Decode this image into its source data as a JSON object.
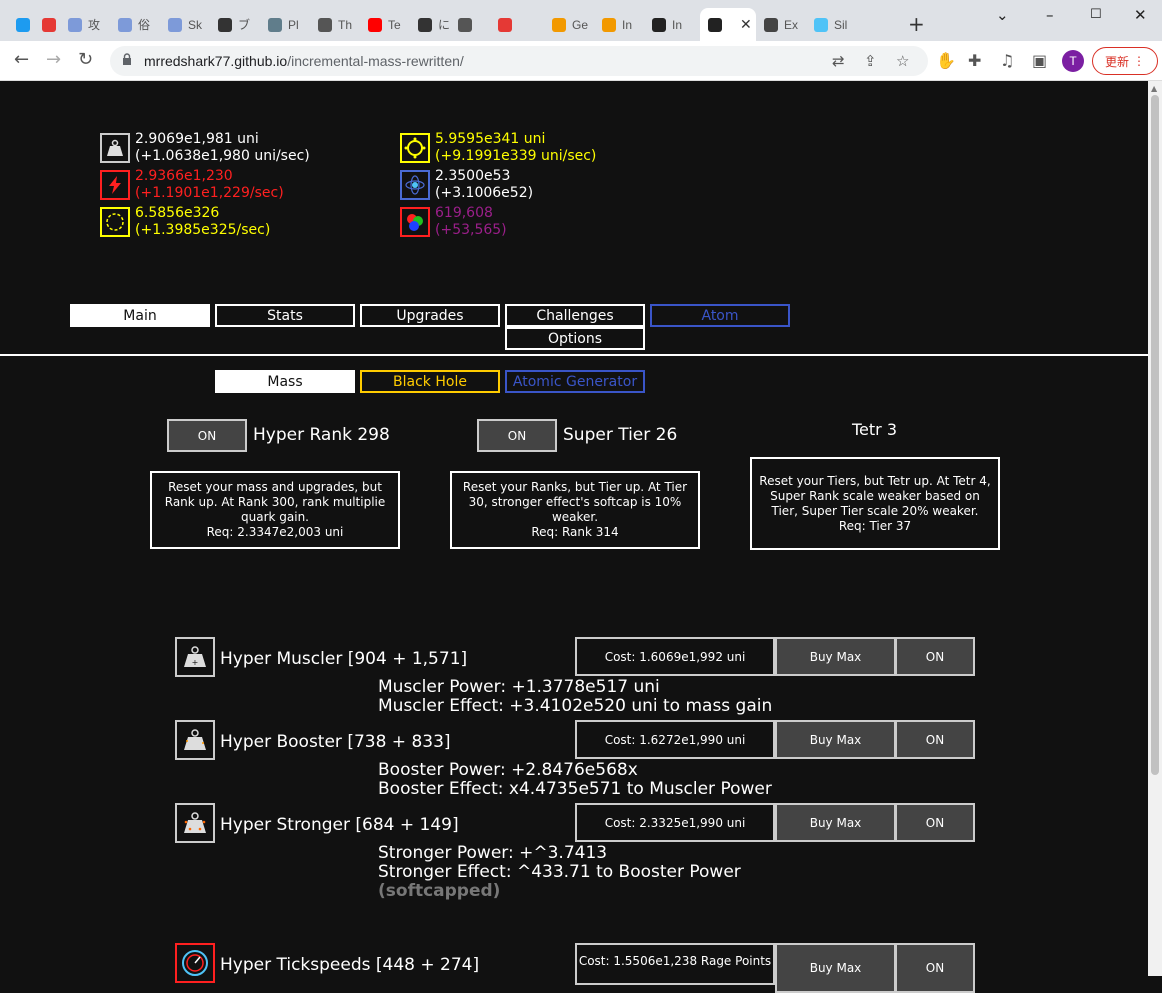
{
  "browser": {
    "tabs": [
      {
        "label": "",
        "color": "#1d9bf0"
      },
      {
        "label": "",
        "color": "#e53935"
      },
      {
        "label": "攻",
        "color": "#7d9ad9"
      },
      {
        "label": "俗",
        "color": "#7d9ad9"
      },
      {
        "label": "Sk",
        "color": "#7d9ad9"
      },
      {
        "label": "ブ",
        "color": "#333333"
      },
      {
        "label": "Pl",
        "color": "#607d8b"
      },
      {
        "label": "Th",
        "color": "#555555"
      },
      {
        "label": "Te",
        "color": "#ff0000"
      },
      {
        "label": "に",
        "color": "#333333"
      },
      {
        "label": "",
        "color": "#555555"
      },
      {
        "label": "",
        "color": "#e53935"
      },
      {
        "label": "Ge",
        "color": "#f29900"
      },
      {
        "label": "In",
        "color": "#f29900"
      },
      {
        "label": "In",
        "color": "#222222"
      },
      {
        "label": "",
        "color": "#222222"
      },
      {
        "label": "Ex",
        "color": "#444444"
      },
      {
        "label": "Sil",
        "color": "#4fc3f7"
      }
    ],
    "url_host": "mrredshark77.github.io",
    "url_path": "/incremental-mass-rewritten/",
    "avatar": "T",
    "update_label": "更新"
  },
  "resources": {
    "mass": {
      "value": "2.9069e1,981 uni",
      "rate": "(+1.0638e1,980 uni/sec)",
      "color": "#ffffff"
    },
    "rage": {
      "value": "2.9366e1,230",
      "rate": "(+1.1901e1,229/sec)",
      "color": "#ff2020"
    },
    "dark_matter": {
      "value": "6.5856e326",
      "rate": "(+1.3985e325/sec)",
      "color": "#ffff00"
    },
    "black_hole": {
      "value": "5.9595e341 uni",
      "rate": "(+9.1991e339 uni/sec)",
      "color": "#ffff00"
    },
    "atom": {
      "value": "2.3500e53",
      "rate": "(+3.1006e52)",
      "color": "#ffffff"
    },
    "quark": {
      "value": "619,608",
      "rate": "(+53,565)",
      "color": "#9b1f8a"
    }
  },
  "main_tabs": [
    "Main",
    "Stats",
    "Upgrades",
    "Challenges",
    "Atom",
    "Options"
  ],
  "sub_tabs": [
    "Mass",
    "Black Hole",
    "Atomic Generator"
  ],
  "ranks": {
    "rank": {
      "toggle": "ON",
      "name": "Hyper Rank 298",
      "desc": "Reset your mass and upgrades, but Rank up. At Rank 300, rank multiplie quark gain.",
      "req": "Req: 2.3347e2,003 uni"
    },
    "tier": {
      "toggle": "ON",
      "name": "Super Tier 26",
      "desc": "Reset your Ranks, but Tier up. At Tier 30, stronger effect's softcap is 10% weaker.",
      "req": "Req: Rank 314"
    },
    "tetr": {
      "name": "Tetr 3",
      "desc": "Reset your Tiers, but Tetr up. At Tetr 4, Super Rank scale weaker based on Tier, Super Tier scale 20% weaker.",
      "req": "Req: Tier 37"
    }
  },
  "upgrades": [
    {
      "name": "Hyper Muscler [904 + 1,571]",
      "cost": "Cost: 1.6069e1,992 uni",
      "buymax": "Buy Max",
      "toggle": "ON",
      "line1": "Muscler Power: +1.3778e517 uni",
      "line2": "Muscler Effect: +3.4102e520 uni to mass gain"
    },
    {
      "name": "Hyper Booster [738 + 833]",
      "cost": "Cost: 1.6272e1,990 uni",
      "buymax": "Buy Max",
      "toggle": "ON",
      "line1": "Booster Power: +2.8476e568x",
      "line2": "Booster Effect: x4.4735e571 to Muscler Power"
    },
    {
      "name": "Hyper Stronger [684 + 149]",
      "cost": "Cost: 2.3325e1,990 uni",
      "buymax": "Buy Max",
      "toggle": "ON",
      "line1": "Stronger Power: +^3.7413",
      "line2": "Stronger Effect: ^433.71 to Booster Power",
      "line3": "(softcapped)"
    },
    {
      "name": "Hyper Tickspeeds [448 + 274]",
      "cost": "Cost: 1.5506e1,238 Rage Points",
      "buymax": "Buy Max",
      "toggle": "ON"
    }
  ]
}
